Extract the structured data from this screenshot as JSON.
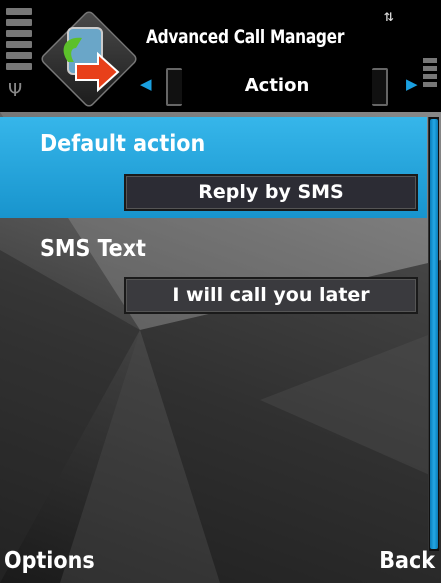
{
  "status": {
    "app_title": "Advanced Call Manager",
    "signal_icon": "signal-strength-icon",
    "battery_icon": "battery-icon",
    "connectivity_icon": "usb-connection-icon"
  },
  "tabs": {
    "current": "Action",
    "left_arrow_icon": "arrow-left-icon",
    "right_arrow_icon": "arrow-right-icon"
  },
  "settings": {
    "items": [
      {
        "label": "Default action",
        "value": "Reply by SMS",
        "selected": true
      },
      {
        "label": "SMS Text",
        "value": "I will call you later",
        "selected": false
      }
    ]
  },
  "softkeys": {
    "left": "Options",
    "right": "Back"
  },
  "colors": {
    "highlight": "#1fa2dd",
    "accent": "#1aa0e0"
  }
}
